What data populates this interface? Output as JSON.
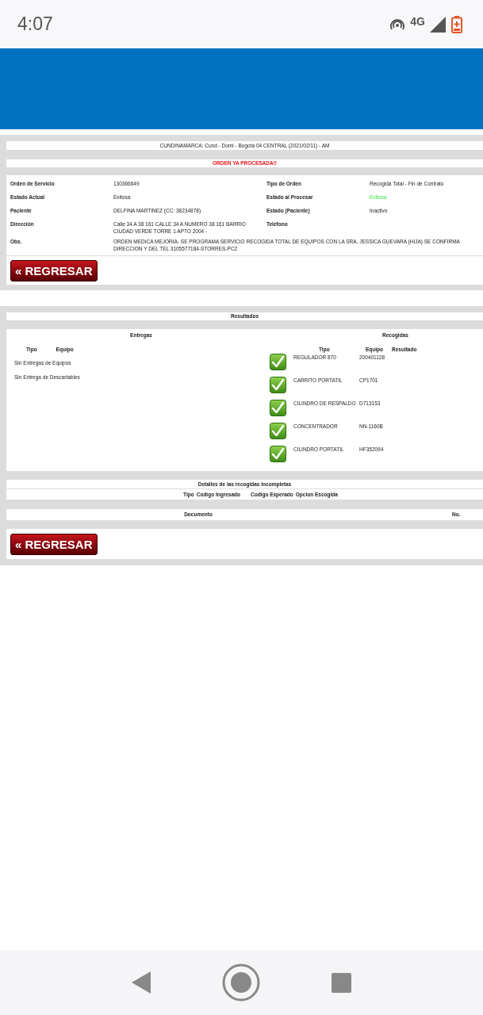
{
  "status_bar": {
    "time": "4:07",
    "network": "4G"
  },
  "header_line": "CUNDINAMARCA: Cund - Domi - Bogota 04 CENTRAL (2021/02/11) - AM",
  "alert": "ORDEN YA PROCESADA!!",
  "details": [
    {
      "label": "Orden de Servicio",
      "value": "130366649",
      "label_2": "Tipo de Orden",
      "value_2": "Recogida Total - Fin de Contrato",
      "success": false
    },
    {
      "label": "Estado Actual",
      "value": "Exitosa",
      "label_2": "Estado al Procesar",
      "value_2": "Exitosa",
      "success": true
    },
    {
      "label": "Paciente",
      "value": "DELFINA MARTINEZ (CC: 38234878)",
      "label_2": "Estado (Paciente)",
      "value_2": "Inactivo",
      "success": false
    },
    {
      "label": "Dirección",
      "value": "Calle 34 A 38 161 CALLE 34 A NUMERO 38 161 BARRIO CIUDAD VERDE TORRE 1 APTO 2004 -",
      "label_2": "Teléfono"
    }
  ],
  "obs": {
    "label": "Obs.",
    "value": "ORDEN MEDICA MEJORIA- SE PROGRAMA SERVICIO RECOGIDA TOTAL DE EQUIPOS CON LA SRA. JESSICA GUEVARA (HIJA) SE CONFIRMA DIRECCION Y DEL TEL 3105577184-STORRES-PC2"
  },
  "back_button": "« REGRESAR",
  "results": {
    "title": "Resultados",
    "deliveries": {
      "title": "Entregas",
      "columns": [
        "Tipo",
        "Equipo"
      ],
      "rows": [
        "Sin Entregas de Equipos",
        "Sin Entrega de Descartables"
      ]
    },
    "pickups": {
      "title": "Recogidas",
      "columns": [
        "Tipo",
        "Equipo",
        "Resultado"
      ],
      "rows": [
        {
          "tipo": "REGULADOR 870",
          "equipo": "200401128"
        },
        {
          "tipo": "CARRITO PORTATIL",
          "equipo": "CP1701"
        },
        {
          "tipo": "CILINDRO DE RESPALDO",
          "equipo": "D713153"
        },
        {
          "tipo": "CONCENTRADOR",
          "equipo": "NN-1160B"
        },
        {
          "tipo": "CILINDRO PORTATIL",
          "equipo": "HF352094"
        }
      ]
    }
  },
  "incomplete": {
    "title": "Detalles de las recogidas incompletas",
    "columns": [
      "Tipo",
      "Codigo Ingresado",
      "Codigo Esperado",
      "Opcion Escogida"
    ]
  },
  "documents": {
    "columns": [
      "Documento",
      "No."
    ]
  },
  "back_button_2": "« REGRESAR"
}
